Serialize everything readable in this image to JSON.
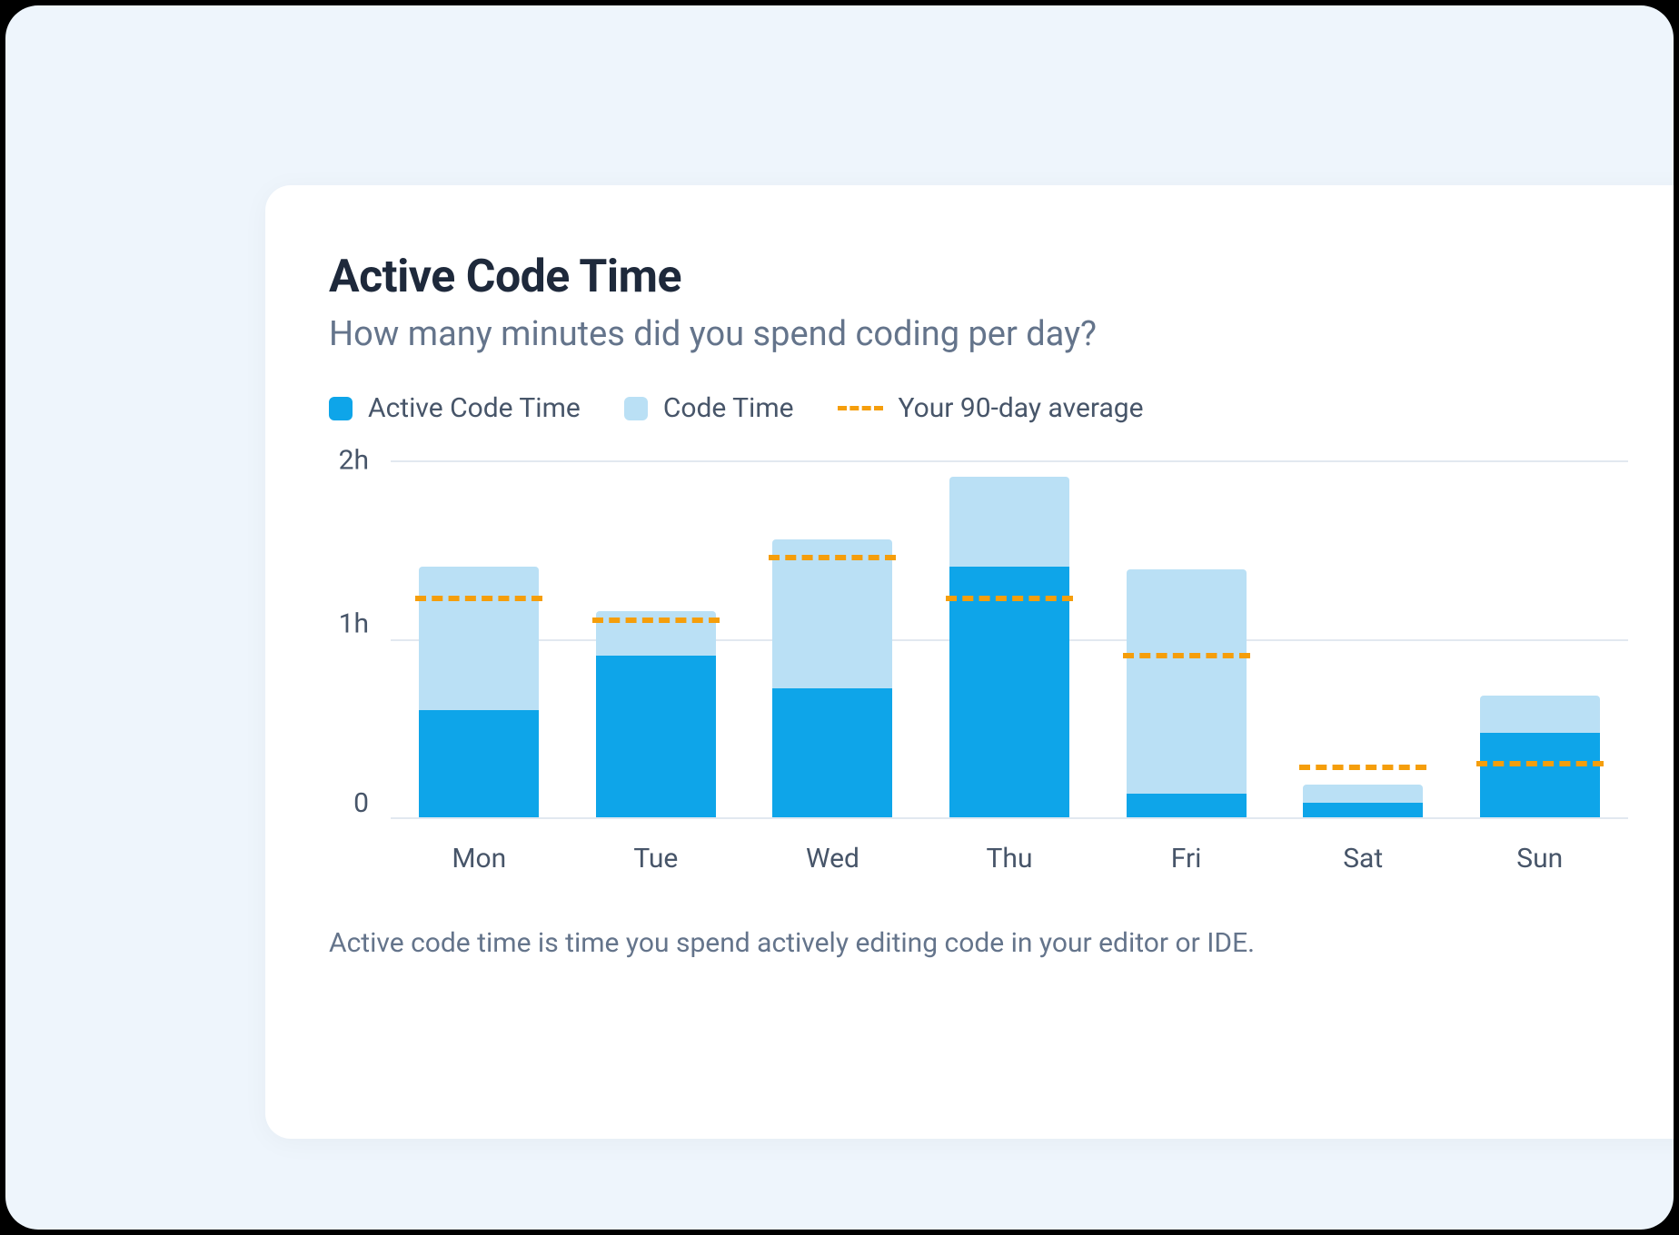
{
  "title": "Active Code Time",
  "subtitle": "How many minutes did you spend coding per day?",
  "legend": {
    "active": "Active Code Time",
    "code": "Code Time",
    "avg": "Your 90-day average"
  },
  "yaxis": {
    "h2": "2h",
    "h1": "1h",
    "h0": "0"
  },
  "xaxis": [
    "Mon",
    "Tue",
    "Wed",
    "Thu",
    "Fri",
    "Sat",
    "Sun"
  ],
  "footer": "Active code time is time you spend actively editing code in your editor or IDE.",
  "colors": {
    "active": "#0ea5e9",
    "code": "#bae0f5",
    "avg": "#f59e0b"
  },
  "chart_data": {
    "type": "bar",
    "categories": [
      "Mon",
      "Tue",
      "Wed",
      "Thu",
      "Fri",
      "Sat",
      "Sun"
    ],
    "series": [
      {
        "name": "Active Code Time",
        "values": [
          0.6,
          0.9,
          0.72,
          1.4,
          0.13,
          0.08,
          0.47
        ],
        "unit": "hours"
      },
      {
        "name": "Code Time",
        "values": [
          1.4,
          1.15,
          1.55,
          1.9,
          1.38,
          0.18,
          0.68
        ],
        "unit": "hours"
      },
      {
        "name": "Your 90-day average",
        "values": [
          1.22,
          1.1,
          1.45,
          1.22,
          0.9,
          0.28,
          0.3
        ],
        "unit": "hours",
        "style": "dashed"
      }
    ],
    "title": "Active Code Time",
    "subtitle": "How many minutes did you spend coding per day?",
    "ylabel": "",
    "xlabel": "",
    "ylim": [
      0,
      2
    ],
    "yticks": [
      "0",
      "1h",
      "2h"
    ]
  }
}
